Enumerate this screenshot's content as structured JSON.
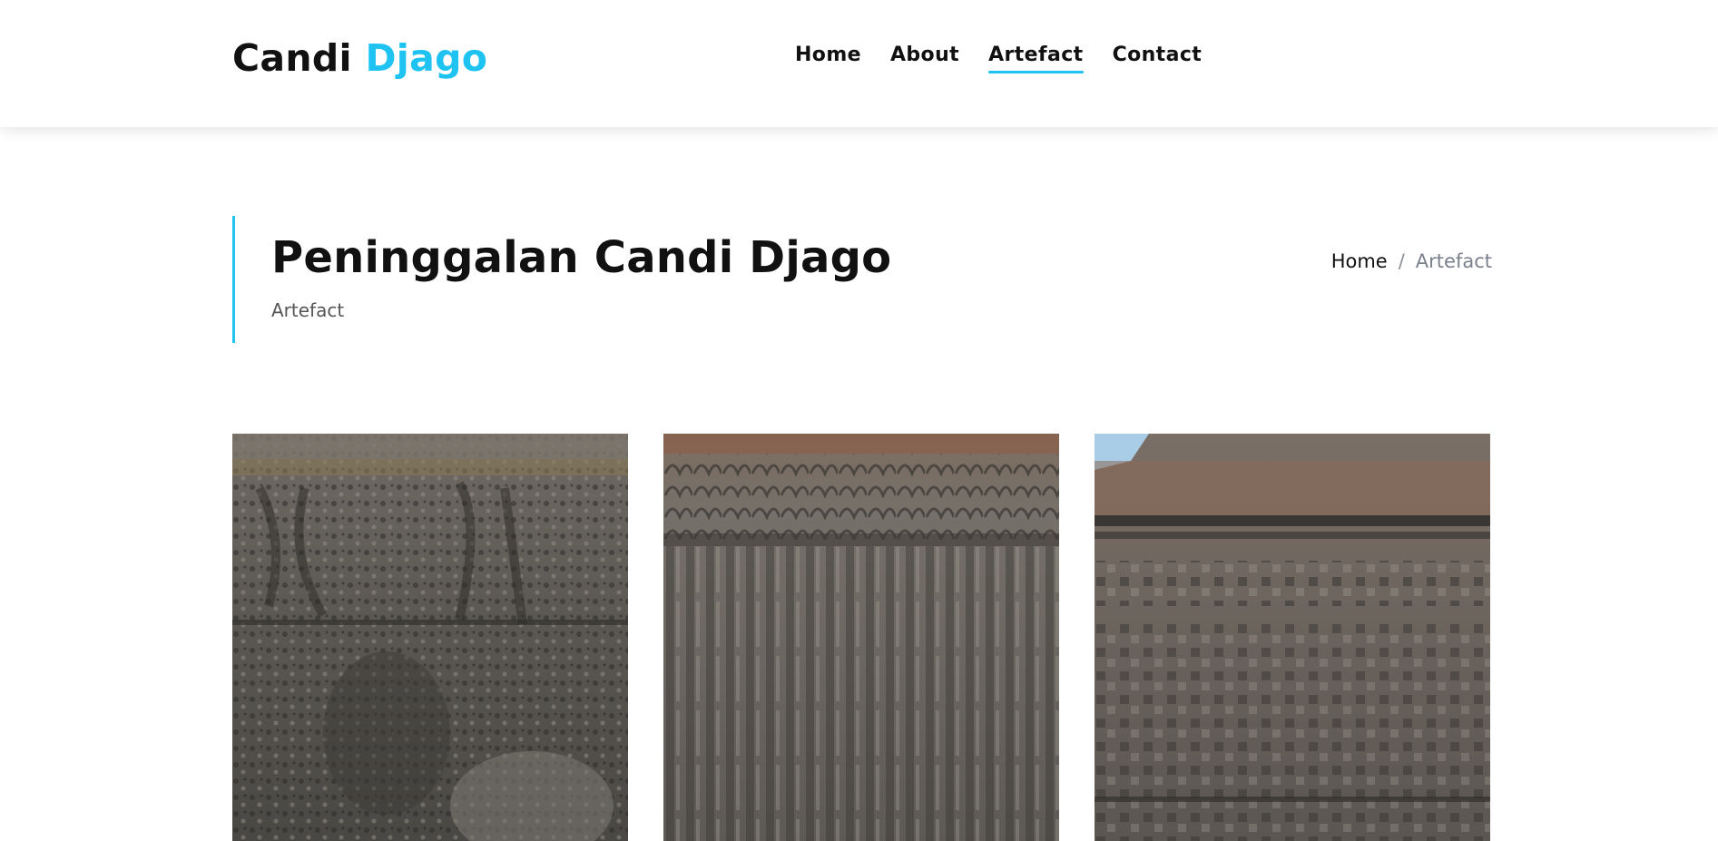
{
  "header": {
    "brand_part1": "Candi",
    "brand_part2": "Djago",
    "accent_color": "#1ec3f2"
  },
  "nav": {
    "items": [
      {
        "label": "Home"
      },
      {
        "label": "About"
      },
      {
        "label": "Artefact",
        "active": true
      },
      {
        "label": "Contact"
      }
    ]
  },
  "intro": {
    "title": "Peninggalan Candi Djago",
    "subtitle": "Artefact"
  },
  "breadcrumb": {
    "home": "Home",
    "separator": "/",
    "current": "Artefact"
  },
  "gallery": {
    "items": [
      {
        "icon": "relief-photo",
        "description": "stone relief carving"
      },
      {
        "icon": "relief-photo",
        "description": "stone relief carving"
      },
      {
        "icon": "relief-photo",
        "description": "temple wall relief"
      }
    ]
  }
}
